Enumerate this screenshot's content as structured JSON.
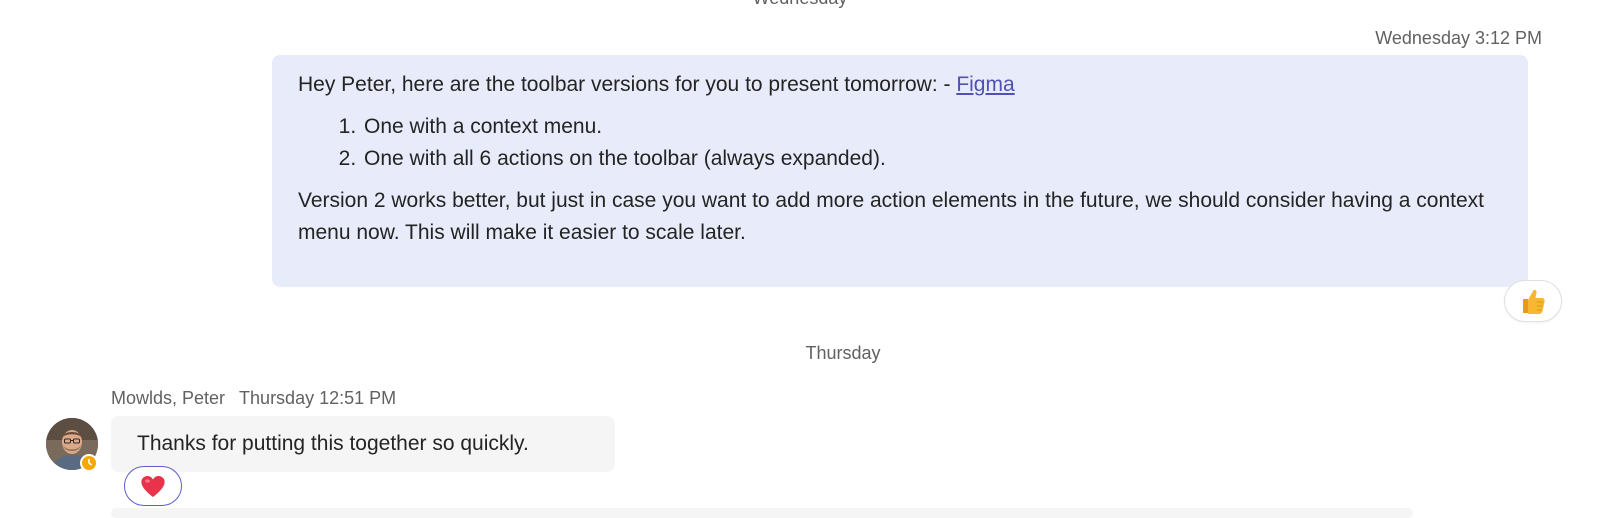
{
  "dividers": {
    "top": "Wednesday",
    "middle": "Thursday"
  },
  "outgoing": {
    "timestamp": "Wednesday 3:12 PM",
    "intro": "Hey Peter, here are the toolbar versions for you to present tomorrow: - ",
    "link_label": "Figma",
    "list": [
      "One with a context menu.",
      "One with all 6 actions on the toolbar (always expanded)."
    ],
    "closing": "Version 2 works better, but just in case you want to add more action elements in the future, we should consider having a context menu now. This will make it easier to scale later.",
    "reaction": "thumbs-up"
  },
  "incoming": {
    "sender": "Mowlds, Peter",
    "timestamp": "Thursday 12:51 PM",
    "text": "Thanks for putting this together so quickly.",
    "reaction": "heart",
    "status": "away"
  },
  "colors": {
    "outgoing_bubble": "#e8ebfa",
    "incoming_bubble": "#f5f5f5",
    "link": "#4f52b2",
    "away_status": "#f6a800",
    "heart": "#e8334a",
    "thumb": "#f7b733"
  }
}
